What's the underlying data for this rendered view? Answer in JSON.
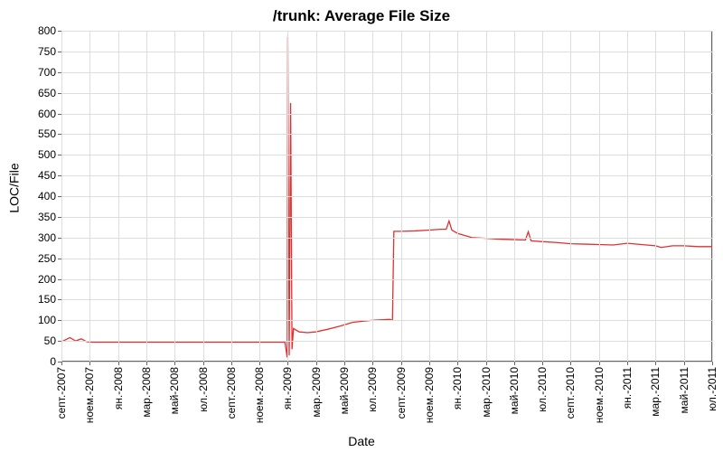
{
  "chart_data": {
    "type": "line",
    "title": "/trunk: Average File Size",
    "xlabel": "Date",
    "ylabel": "LOC/File",
    "ylim": [
      0,
      800
    ],
    "yticks": [
      0,
      50,
      100,
      150,
      200,
      250,
      300,
      350,
      400,
      450,
      500,
      550,
      600,
      650,
      700,
      750,
      800
    ],
    "x_categories": [
      "септ.-2007",
      "ноем.-2007",
      "ян.-2008",
      "мар.-2008",
      "май-2008",
      "юл.-2008",
      "септ.-2008",
      "ноем.-2008",
      "ян.-2009",
      "мар.-2009",
      "май-2009",
      "юл.-2009",
      "септ.-2009",
      "ноем.-2009",
      "ян.-2010",
      "мар.-2010",
      "май-2010",
      "юл.-2010",
      "септ.-2010",
      "ноем.-2010",
      "ян.-2011",
      "мар.-2011",
      "май-2011",
      "юл.-2011"
    ],
    "series": [
      {
        "name": "Average File Size",
        "color": "#e03030",
        "points": [
          {
            "xi": 0.0,
            "y": 48
          },
          {
            "xi": 0.3,
            "y": 58
          },
          {
            "xi": 0.5,
            "y": 50
          },
          {
            "xi": 0.7,
            "y": 55
          },
          {
            "xi": 0.9,
            "y": 48
          },
          {
            "xi": 1.1,
            "y": 47
          },
          {
            "xi": 2.0,
            "y": 47
          },
          {
            "xi": 3.0,
            "y": 47
          },
          {
            "xi": 4.0,
            "y": 47
          },
          {
            "xi": 5.0,
            "y": 47
          },
          {
            "xi": 6.0,
            "y": 47
          },
          {
            "xi": 7.0,
            "y": 47
          },
          {
            "xi": 7.9,
            "y": 47
          },
          {
            "xi": 7.98,
            "y": 10
          },
          {
            "xi": 8.0,
            "y": 785
          },
          {
            "xi": 8.05,
            "y": 15
          },
          {
            "xi": 8.1,
            "y": 625
          },
          {
            "xi": 8.15,
            "y": 30
          },
          {
            "xi": 8.2,
            "y": 80
          },
          {
            "xi": 8.4,
            "y": 72
          },
          {
            "xi": 8.7,
            "y": 70
          },
          {
            "xi": 9.0,
            "y": 72
          },
          {
            "xi": 9.4,
            "y": 78
          },
          {
            "xi": 9.8,
            "y": 85
          },
          {
            "xi": 10.3,
            "y": 95
          },
          {
            "xi": 11.0,
            "y": 100
          },
          {
            "xi": 11.6,
            "y": 102
          },
          {
            "xi": 11.7,
            "y": 100
          },
          {
            "xi": 11.75,
            "y": 315
          },
          {
            "xi": 12.0,
            "y": 315
          },
          {
            "xi": 12.5,
            "y": 316
          },
          {
            "xi": 13.0,
            "y": 318
          },
          {
            "xi": 13.4,
            "y": 320
          },
          {
            "xi": 13.6,
            "y": 320
          },
          {
            "xi": 13.7,
            "y": 340
          },
          {
            "xi": 13.8,
            "y": 318
          },
          {
            "xi": 14.0,
            "y": 310
          },
          {
            "xi": 14.5,
            "y": 300
          },
          {
            "xi": 15.0,
            "y": 298
          },
          {
            "xi": 15.5,
            "y": 296
          },
          {
            "xi": 16.0,
            "y": 295
          },
          {
            "xi": 16.4,
            "y": 294
          },
          {
            "xi": 16.5,
            "y": 314
          },
          {
            "xi": 16.6,
            "y": 292
          },
          {
            "xi": 17.0,
            "y": 290
          },
          {
            "xi": 17.5,
            "y": 288
          },
          {
            "xi": 18.0,
            "y": 285
          },
          {
            "xi": 18.5,
            "y": 284
          },
          {
            "xi": 19.0,
            "y": 283
          },
          {
            "xi": 19.5,
            "y": 282
          },
          {
            "xi": 20.0,
            "y": 286
          },
          {
            "xi": 20.5,
            "y": 283
          },
          {
            "xi": 21.0,
            "y": 280
          },
          {
            "xi": 21.2,
            "y": 276
          },
          {
            "xi": 21.6,
            "y": 280
          },
          {
            "xi": 22.0,
            "y": 280
          },
          {
            "xi": 22.5,
            "y": 278
          },
          {
            "xi": 23.0,
            "y": 278
          }
        ]
      }
    ]
  }
}
